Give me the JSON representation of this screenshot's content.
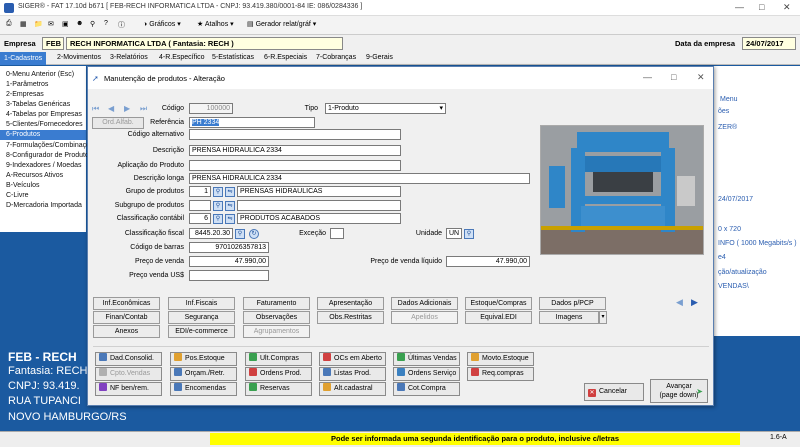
{
  "window": {
    "title": "SIGER® - FAT 17.10d b671 [ FEB-RECH INFORMATICA LTDA - CNPJ: 93.419.380/0001-84 IE: 086/0284336 ]"
  },
  "toolbar": {
    "graficos": "Gráficos",
    "atalhos": "Atalhos",
    "gerador": "Gerador relat/gráf"
  },
  "empresa": {
    "label": "Empresa",
    "code": "FEB",
    "name": "RECH INFORMATICA LTDA ( Fantasia: RECH )",
    "date_label": "Data da empresa",
    "date": "24/07/2017"
  },
  "menubar": [
    "1-Cadastros",
    "2-Movimentos",
    "3-Relatórios",
    "4-R.Específico",
    "5-Estatísticas",
    "6-R.Especiais",
    "7-Cobranças",
    "9-Gerais"
  ],
  "leftmenu": [
    "0-Menu Anterior (Esc)",
    "1-Parâmetros",
    "2-Empresas",
    "3-Tabelas Genéricas",
    "4-Tabelas por Empresas",
    "5-Clientes/Fornecedores",
    "6-Produtos",
    "7-Formulações/Combinações",
    "8-Configurador de Produtos",
    "9-Indexadores / Moedas",
    "A-Recursos Ativos",
    "B-Veículos",
    "C-Livre",
    "D-Mercadoria Importada"
  ],
  "right_pane": [
    "Menu",
    "ões",
    "ZER®",
    "24/07/2017",
    "0 x 720",
    "INFO ( 1000 Megabits/s )",
    "e4",
    "ção/atualização",
    "VENDAS\\"
  ],
  "company_info": {
    "name": "FEB - RECH",
    "fantasia": "Fantasia: RECH",
    "cnpj": "CNPJ: 93.419.",
    "street": "RUA TUPANCI",
    "city": "NOVO HAMBURGO/RS"
  },
  "status": {
    "message": "Pode ser informada uma segunda identificação para o produto, inclusive c/letras",
    "version": "1.6-A"
  },
  "dialog": {
    "title": "Manutenção de produtos - Alteração",
    "labels": {
      "codigo": "Código",
      "tipo": "Tipo",
      "referencia": "Referência",
      "ordalfab": "Ord.Alfab.",
      "codigo_alt": "Código alternativo",
      "descricao": "Descrição",
      "aplicacao": "Aplicação do Produto",
      "descricao_longa": "Descrição longa",
      "grupo": "Grupo de produtos",
      "subgrupo": "Subgrupo de produtos",
      "classif_contabil": "Classificação contábil",
      "classif_fiscal": "Classificação fiscal",
      "excecao": "Exceção",
      "unidade": "Unidade",
      "cod_barras": "Código de barras",
      "preco_venda": "Preço de venda",
      "preco_liquido": "Preço de venda líquido",
      "preco_usd": "Preço venda US$"
    },
    "values": {
      "codigo": "100000",
      "tipo": "1-Produto",
      "referencia": "PH 2334",
      "descricao": "PRENSA HIDRAULICA 2334",
      "descricao_longa": "PRENSA HIDRAULICA 2334",
      "grupo_code": "1",
      "grupo_name": "PRENSAS HIDRAULICAS",
      "classif_code": "6",
      "classif_name": "PRODUTOS ACABADOS",
      "classif_fiscal": "8445.20.30",
      "unidade": "UN",
      "cod_barras": "9701026357813",
      "preco_venda": "47.990,00",
      "preco_liquido": "47.990,00"
    },
    "tabs_row1": [
      "Inf.Econômicas",
      "Inf.Fiscais",
      "Faturamento",
      "Apresentação",
      "Dados Adicionais",
      "Estoque/Compras",
      "Dados p/PCP"
    ],
    "tabs_row2": [
      "Finan/Contab",
      "Segurança",
      "Observações",
      "Obs.Restritas",
      "Apelidos",
      "Equival.EDI",
      "Imagens"
    ],
    "tabs_row3": [
      "Anexos",
      "EDI/e-commerce",
      "Agrupamentos"
    ],
    "actions_row1": [
      "Dad.Consolid.",
      "Pos.Estoque",
      "Ult.Compras",
      "OCs em Aberto",
      "Últimas Vendas",
      "Movto.Estoque"
    ],
    "actions_row2": [
      "Cpto.Vendas",
      "Orçam./Retr.",
      "Ordens Prod.",
      "Listas Prod.",
      "Ordens Serviço",
      "Req.compras"
    ],
    "actions_row3": [
      "NF ben/rem.",
      "Encomendas",
      "Reservas",
      "Alt.cadastral",
      "Cot.Compra"
    ],
    "cancel": "Cancelar",
    "next_line1": "Avançar",
    "next_line2": "(page down)"
  },
  "colors": {
    "desktop": "#1b5aa0",
    "status_yellow": "#ffff00",
    "highlight": "#3a7cd0"
  }
}
